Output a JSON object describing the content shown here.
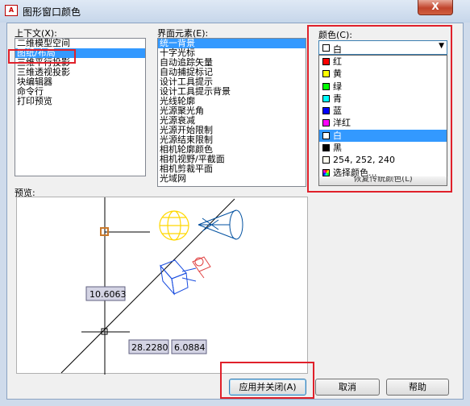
{
  "window": {
    "title": "图形窗口颜色",
    "icon_text": "A",
    "close_label": "X"
  },
  "context": {
    "label": "上下文(X):",
    "items": [
      "二维模型空间",
      "图纸/布局",
      "三维平行投影",
      "三维透视投影",
      "块编辑器",
      "命令行",
      "打印预览"
    ],
    "selected_index": 1
  },
  "elements": {
    "label": "界面元素(E):",
    "items": [
      "统一背景",
      "十字光标",
      "自动追踪矢量",
      "自动捕捉标记",
      "设计工具提示",
      "设计工具提示背景",
      "光线轮廓",
      "光源聚光角",
      "光源衰减",
      "光源开始限制",
      "光源结束限制",
      "相机轮廓颜色",
      "相机视野/平截面",
      "相机剪裁平面",
      "光域网"
    ],
    "selected_index": 0
  },
  "color": {
    "label": "颜色(C):",
    "current": "白",
    "current_swatch": "#ffffff",
    "options": [
      {
        "label": "红",
        "swatch": "#ff0000"
      },
      {
        "label": "黄",
        "swatch": "#ffff00"
      },
      {
        "label": "绿",
        "swatch": "#00ff00"
      },
      {
        "label": "青",
        "swatch": "#00ffff"
      },
      {
        "label": "蓝",
        "swatch": "#0000ff"
      },
      {
        "label": "洋红",
        "swatch": "#ff00ff"
      },
      {
        "label": "白",
        "swatch": "#ffffff"
      },
      {
        "label": "黑",
        "swatch": "#000000"
      },
      {
        "label": "254, 252, 240",
        "swatch": "#fefcf0"
      },
      {
        "label": "选择颜色...",
        "swatch": "multicolor"
      }
    ],
    "selected_index": 6,
    "restore_label": "恢复传统颜色(L)"
  },
  "preview": {
    "label": "预览:",
    "dim_vertical": "10.6063",
    "dim_h1": "28.2280",
    "dim_h2": "6.0884"
  },
  "buttons": {
    "apply_close": "应用并关闭(A)",
    "cancel": "取消",
    "help": "帮助"
  },
  "colors": {
    "highlight": "#e0202a",
    "selection": "#3399ff"
  }
}
